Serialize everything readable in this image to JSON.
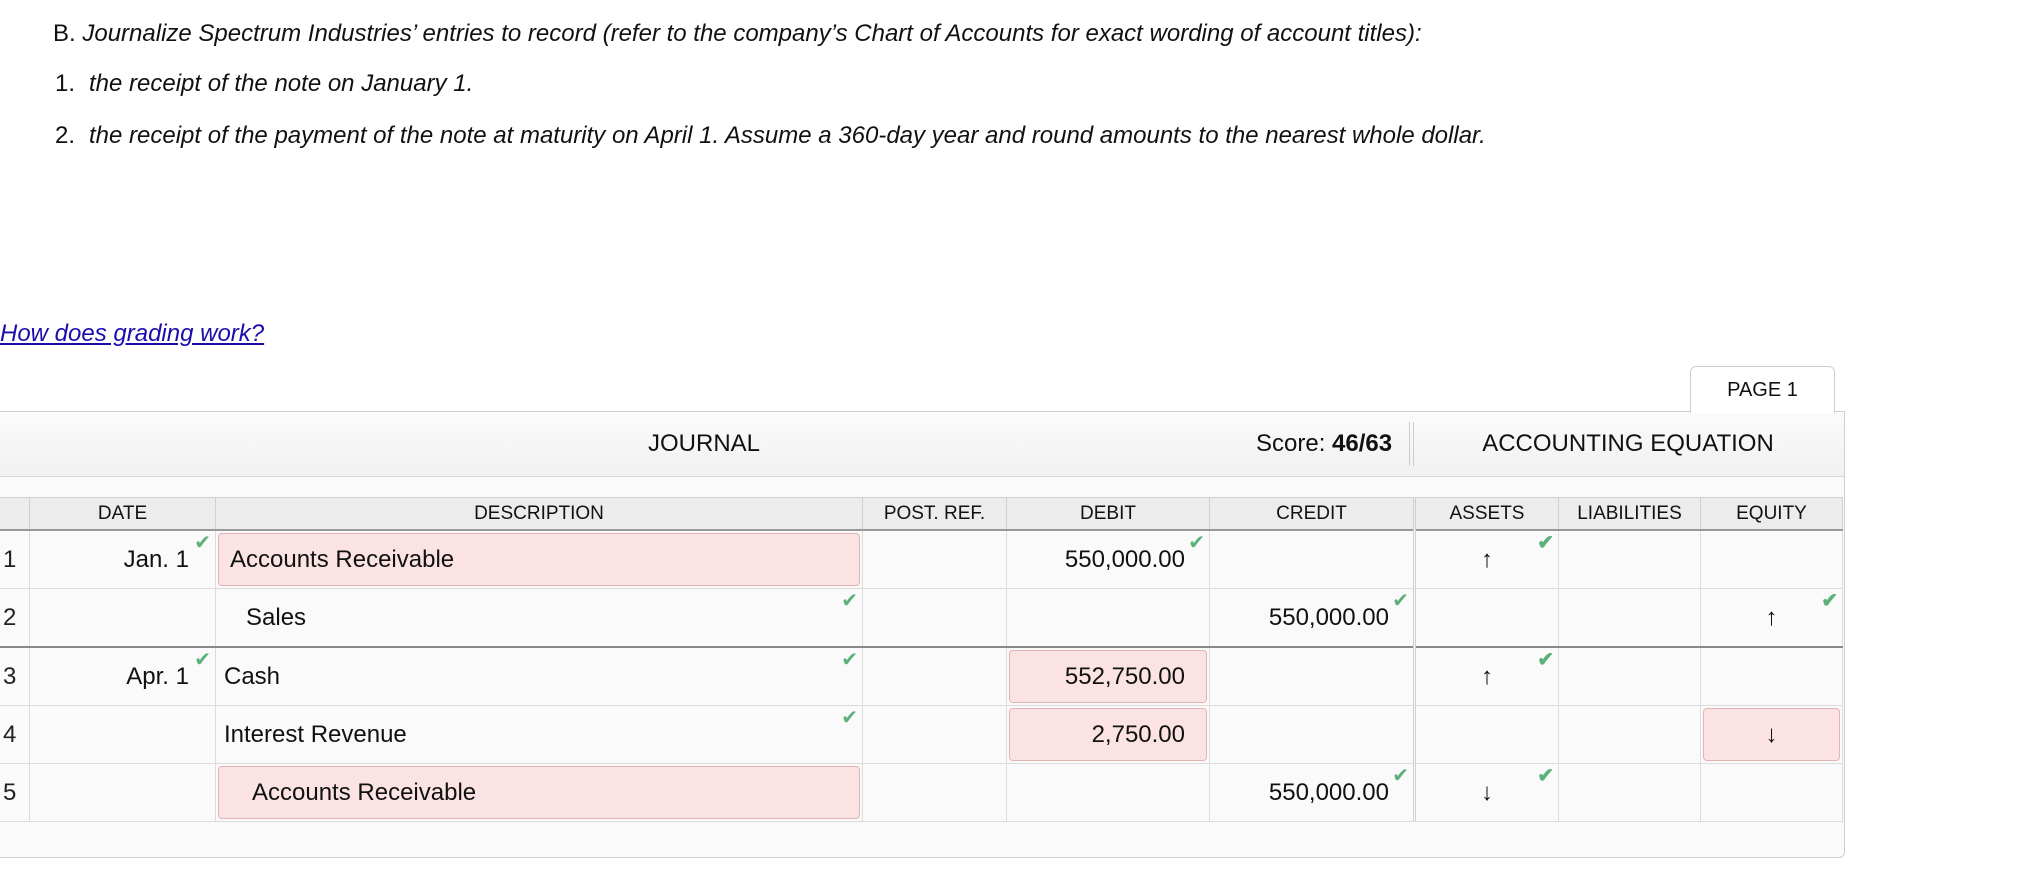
{
  "instructions": {
    "lead": "B.",
    "text": "Journalize Spectrum Industries’ entries to record (refer to the company’s Chart of Accounts for exact wording of account titles):",
    "items": [
      {
        "num": "1.",
        "text": "the receipt of the note on January 1."
      },
      {
        "num": "2.",
        "text": "the receipt of the payment of the note at maturity on April 1. Assume a 360-day year and round amounts to the nearest whole dollar."
      }
    ]
  },
  "help_link": "How does grading work?",
  "page_tab": "PAGE 1",
  "journal": {
    "title": "JOURNAL",
    "score_label": "Score:",
    "score_value": "46/63",
    "equation_title": "ACCOUNTING EQUATION",
    "columns": [
      "DATE",
      "DESCRIPTION",
      "POST. REF.",
      "DEBIT",
      "CREDIT",
      "ASSETS",
      "LIABILITIES",
      "EQUITY"
    ],
    "rows": [
      {
        "num": "1",
        "date": "Jan. 1",
        "description": "Accounts Receivable",
        "post_ref": "",
        "debit": "550,000.00",
        "credit": "",
        "assets": "↑",
        "liabilities": "",
        "equity": ""
      },
      {
        "num": "2",
        "date": "",
        "description": "Sales",
        "post_ref": "",
        "debit": "",
        "credit": "550,000.00",
        "assets": "",
        "liabilities": "",
        "equity": "↑"
      },
      {
        "num": "3",
        "date": "Apr. 1",
        "description": "Cash",
        "post_ref": "",
        "debit": "552,750.00",
        "credit": "",
        "assets": "↑",
        "liabilities": "",
        "equity": ""
      },
      {
        "num": "4",
        "date": "",
        "description": "Interest Revenue",
        "post_ref": "",
        "debit": "2,750.00",
        "credit": "",
        "assets": "",
        "liabilities": "",
        "equity": "↓"
      },
      {
        "num": "5",
        "date": "",
        "description": "Accounts Receivable",
        "post_ref": "",
        "debit": "",
        "credit": "550,000.00",
        "assets": "↓",
        "liabilities": "",
        "equity": ""
      }
    ],
    "check_glyph": "✔",
    "colors": {
      "check": "#5cb07a",
      "error_fill": "#fbe3e3",
      "error_border": "#e3b3b3",
      "link": "#1a0dab"
    }
  }
}
